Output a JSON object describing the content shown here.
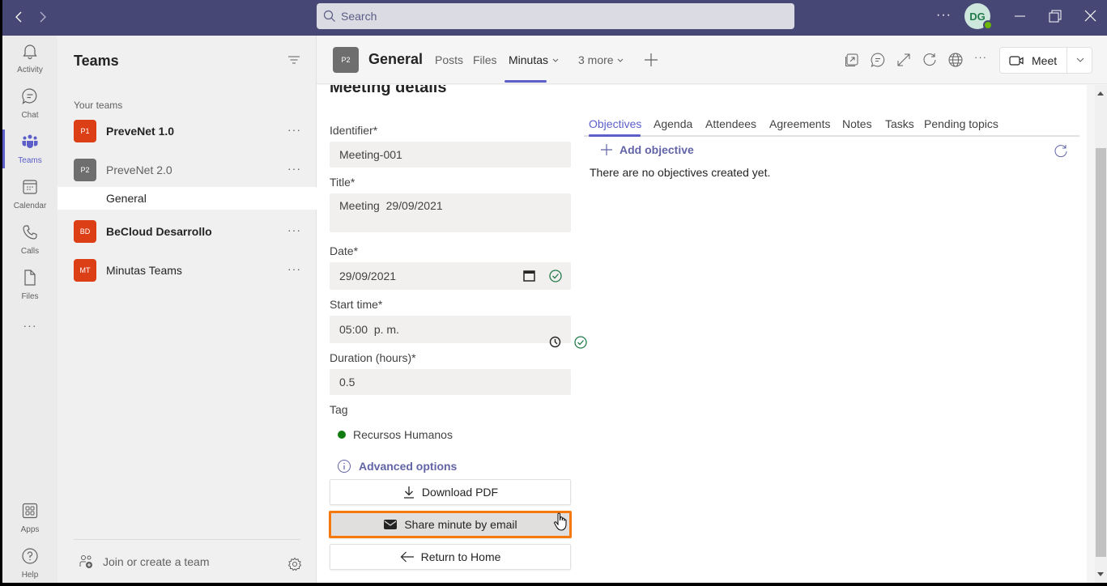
{
  "titlebar": {
    "back_icon": "chevron-left-icon",
    "forward_icon": "chevron-right-icon",
    "search_placeholder": "Search",
    "more_label": "···",
    "avatar_initials": "DG",
    "presence": "available",
    "window_controls": [
      "minimize",
      "restore",
      "close"
    ]
  },
  "rail": {
    "items": [
      {
        "label": "Activity",
        "icon": "bell-icon"
      },
      {
        "label": "Chat",
        "icon": "chat-icon"
      },
      {
        "label": "Teams",
        "icon": "teams-icon",
        "active": true
      },
      {
        "label": "Calendar",
        "icon": "calendar-icon"
      },
      {
        "label": "Calls",
        "icon": "phone-icon"
      },
      {
        "label": "Files",
        "icon": "file-icon"
      }
    ],
    "more_label": "···",
    "bottom": [
      {
        "label": "Apps",
        "icon": "apps-icon"
      },
      {
        "label": "Help",
        "icon": "help-icon"
      }
    ]
  },
  "teams_panel": {
    "title": "Teams",
    "section_label": "Your teams",
    "teams": [
      {
        "initials": "P1",
        "name": "PreveNet 1.0",
        "color": "#dc3e15",
        "bold": true
      },
      {
        "initials": "P2",
        "name": "PreveNet 2.0",
        "color": "#6e6e6e",
        "bold": false,
        "muted": true
      },
      {
        "initials": "BD",
        "name": "BeCloud Desarrollo",
        "color": "#dc3e15",
        "bold": true
      },
      {
        "initials": "MT",
        "name": "Minutas Teams",
        "color": "#dc3e15",
        "bold": false
      }
    ],
    "selected_channel": "General",
    "more_label": "···",
    "join_label": "Join or create a team"
  },
  "header": {
    "channel_initials": "P2",
    "channel_title": "General",
    "tabs": [
      {
        "label": "Posts"
      },
      {
        "label": "Files"
      },
      {
        "label": "Minutas",
        "active": true,
        "has_chevron": true
      },
      {
        "label": "3 more",
        "has_chevron": true
      }
    ],
    "add_tab_icon": "plus-icon",
    "action_icons": [
      "popout-icon",
      "conversation-icon",
      "expand-icon",
      "refresh-icon",
      "globe-icon",
      "more-icon"
    ],
    "more_label": "···",
    "meet_label": "Meet"
  },
  "form": {
    "page_title": "Meeting details",
    "identifier": {
      "label": "Identifier*",
      "value": "Meeting-001"
    },
    "title": {
      "label": "Title*",
      "value": "Meeting  29/09/2021"
    },
    "date": {
      "label": "Date*",
      "value": "29/09/2021",
      "valid": true
    },
    "start_time": {
      "label": "Start time*",
      "value": "05:00  p. m.",
      "valid": true
    },
    "duration": {
      "label": "Duration (hours)*",
      "value": "0.5"
    },
    "tag": {
      "label": "Tag",
      "value": "Recursos Humanos",
      "color": "#107c10"
    },
    "advanced_label": "Advanced options",
    "download_label": "Download PDF",
    "share_label": "Share minute by email",
    "return_label": "Return to Home"
  },
  "details": {
    "tabs": [
      {
        "label": "Objectives",
        "active": true
      },
      {
        "label": "Agenda"
      },
      {
        "label": "Attendees"
      },
      {
        "label": "Agreements"
      },
      {
        "label": "Notes"
      },
      {
        "label": "Tasks"
      },
      {
        "label": "Pending topics"
      }
    ],
    "add_label": "Add objective",
    "empty_text": "There are no objectives created yet."
  },
  "colors": {
    "titlebar": "#464775",
    "accent": "#5b5fc7",
    "link": "#6264a7",
    "highlight": "#f7790d",
    "valid": "#237b4b"
  }
}
